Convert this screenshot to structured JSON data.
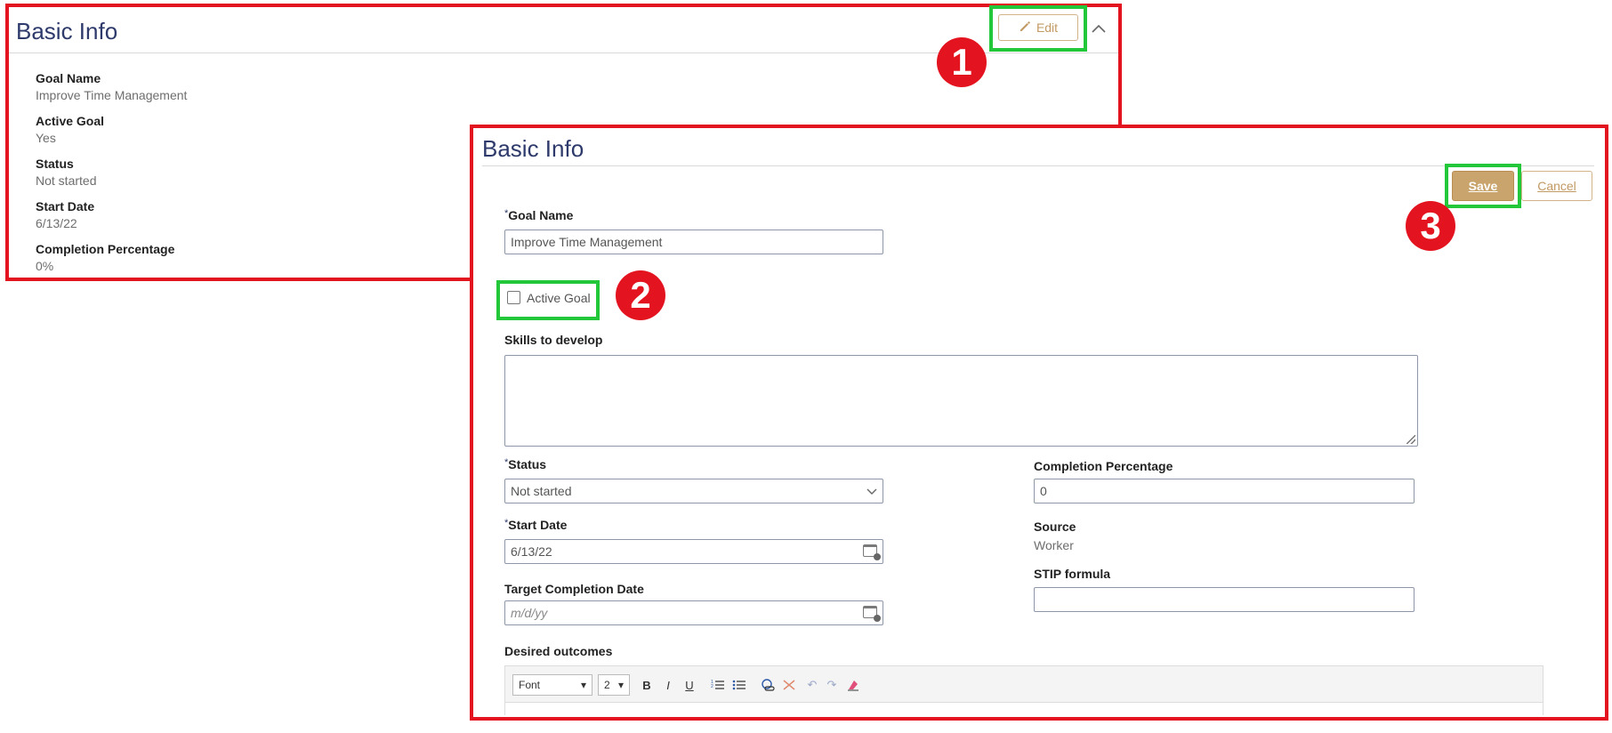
{
  "read_view": {
    "title": "Basic Info",
    "edit_label": "Edit",
    "fields": [
      {
        "label": "Goal Name",
        "value": "Improve Time Management"
      },
      {
        "label": "Active Goal",
        "value": "Yes"
      },
      {
        "label": "Status",
        "value": "Not started"
      },
      {
        "label": "Start Date",
        "value": "6/13/22"
      },
      {
        "label": "Completion Percentage",
        "value": "0%"
      }
    ]
  },
  "edit_view": {
    "title": "Basic Info",
    "save_label": "Save",
    "cancel_label": "Cancel",
    "required_mark": "*",
    "goal_name": {
      "label": "Goal Name",
      "value": "Improve Time Management"
    },
    "active_goal": {
      "label": "Active Goal",
      "checked": false
    },
    "skills": {
      "label": "Skills to develop",
      "value": ""
    },
    "status": {
      "label": "Status",
      "value": "Not started"
    },
    "start_date": {
      "label": "Start Date",
      "value": "6/13/22"
    },
    "target_date": {
      "label": "Target Completion Date",
      "placeholder": "m/d/yy"
    },
    "completion": {
      "label": "Completion Percentage",
      "value": "0"
    },
    "source": {
      "label": "Source",
      "value": "Worker"
    },
    "stip": {
      "label": "STIP formula",
      "value": ""
    },
    "desired_outcomes": {
      "label": "Desired outcomes",
      "font_select": "Font",
      "size_select": "2"
    }
  },
  "markers": [
    "1",
    "2",
    "3"
  ],
  "colors": {
    "highlight_red": "#e3141f",
    "highlight_green": "#22c73a",
    "title_navy": "#2d3a6b",
    "button_gold": "#c9a46c"
  }
}
